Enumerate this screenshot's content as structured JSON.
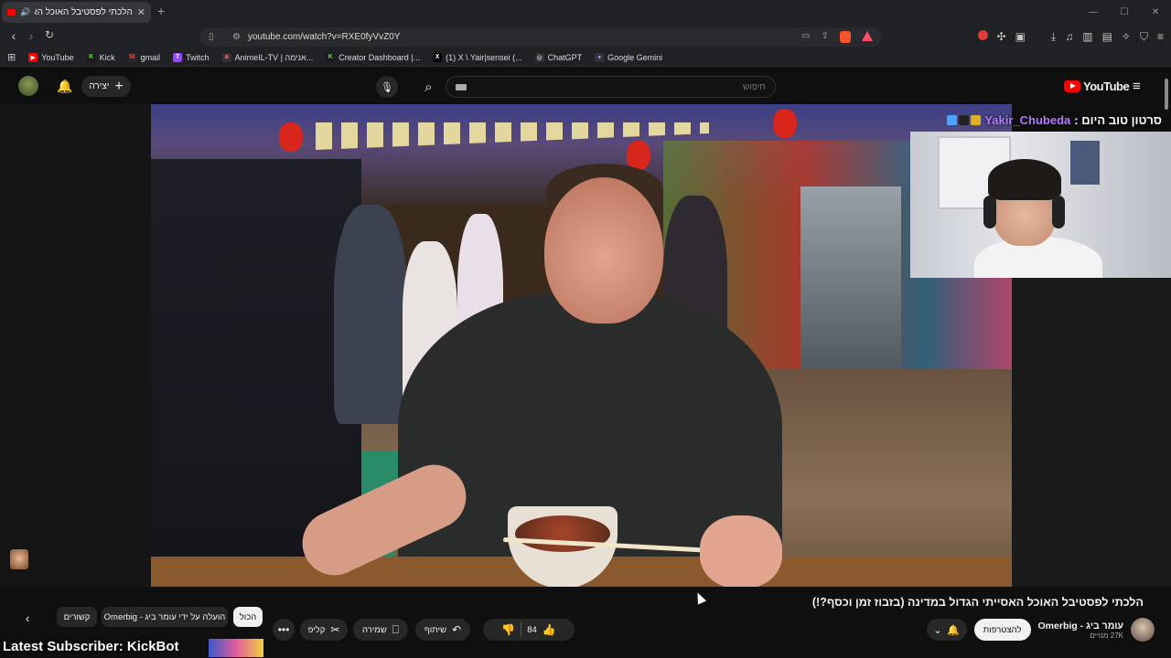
{
  "browser": {
    "tab_title": "הלכתי לפסטיבל האוכל האסיי",
    "url": "youtube.com/watch?v=RXE0fyVvZ0Y",
    "bookmarks": [
      {
        "label": "YouTube",
        "color": "#ff0000",
        "glyph": "▶"
      },
      {
        "label": "Kick",
        "color": "#1a1a1a",
        "glyph": "K"
      },
      {
        "label": "gmail",
        "color": "#2a2a2a",
        "glyph": "M"
      },
      {
        "label": "Twitch",
        "color": "#9146ff",
        "glyph": "T"
      },
      {
        "label": "AnimeIL-TV | אנימה...",
        "color": "#333",
        "glyph": "a"
      },
      {
        "label": "Creator Dashboard |...",
        "color": "#1a1a1a",
        "glyph": "K"
      },
      {
        "label": "(1) X \\ Yair|sensei (...",
        "color": "#000",
        "glyph": "X"
      },
      {
        "label": "ChatGPT",
        "color": "#333",
        "glyph": "◎"
      },
      {
        "label": "Google Gemini",
        "color": "#333",
        "glyph": "✦"
      }
    ]
  },
  "youtube": {
    "create_label": "יצירה",
    "search_placeholder": "חיפוש",
    "logo_text": "YouTube"
  },
  "overlay": {
    "banner_label": "סרטון טוב היום :",
    "banner_user": "Yakir_Chubeda",
    "latest_subscriber": "Latest Subscriber: KickBot"
  },
  "video": {
    "title": "הלכתי לפסטיבל האוכל האסייתי הגדול במדינה (בזבוז זמן וכסף?!)",
    "channel_name": "עומר ביג - Omerbig",
    "subscribers": "27K מנויים",
    "subscribe_label": "להצטרפות",
    "like_count": "84",
    "share_label": "שיתוף",
    "save_label": "שמירה",
    "clip_label": "קליפ"
  },
  "chips": {
    "all": "הכול",
    "uploaded_by": "הועלה על ידי עומר ביג - Omerbig",
    "related": "קשורים"
  },
  "colors": {
    "accent_red": "#ff0000",
    "kick_green": "#53fc18",
    "overlay_user": "#b57aff",
    "background": "#0f0f0f"
  }
}
